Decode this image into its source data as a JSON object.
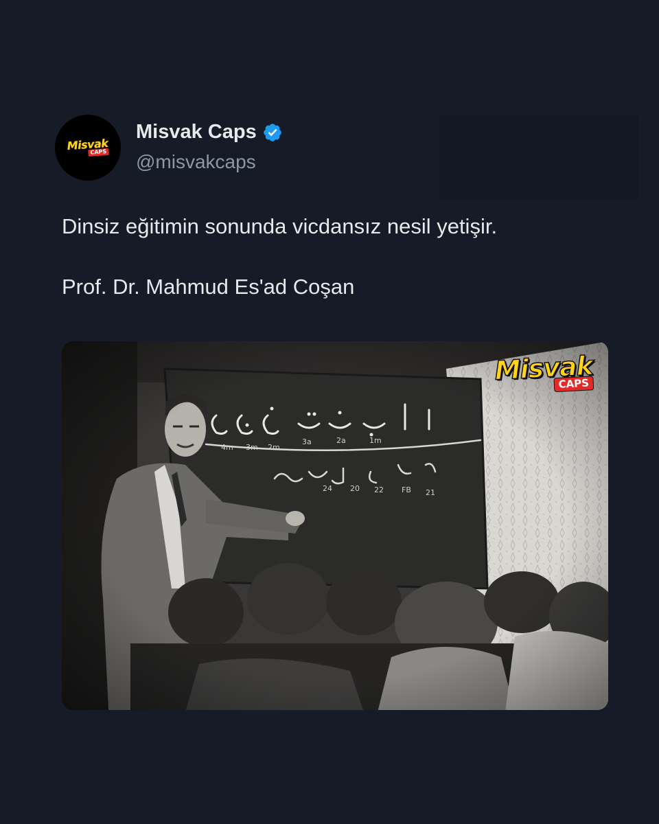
{
  "tweet": {
    "author": {
      "display_name": "Misvak Caps",
      "handle": "@misvakcaps",
      "verified": true,
      "avatar_logo": {
        "main": "Misvak",
        "sub": "CAPS"
      }
    },
    "text_lines": [
      "Dinsiz eğitimin sonunda vicdansız nesil yetişir.",
      "Prof. Dr. Mahmud Es'ad Coşan"
    ],
    "media": {
      "watermark_main": "Misvak",
      "watermark_sub": "CAPS"
    }
  },
  "colors": {
    "background": "#151c28",
    "name_text": "#e7e9ea",
    "handle_text": "#8b98a5",
    "verified_badge": "#1d9bf0",
    "logo_yellow": "#ffd21c",
    "logo_red": "#e32a2a"
  },
  "icons": {
    "verified": "verified-badge-icon"
  }
}
